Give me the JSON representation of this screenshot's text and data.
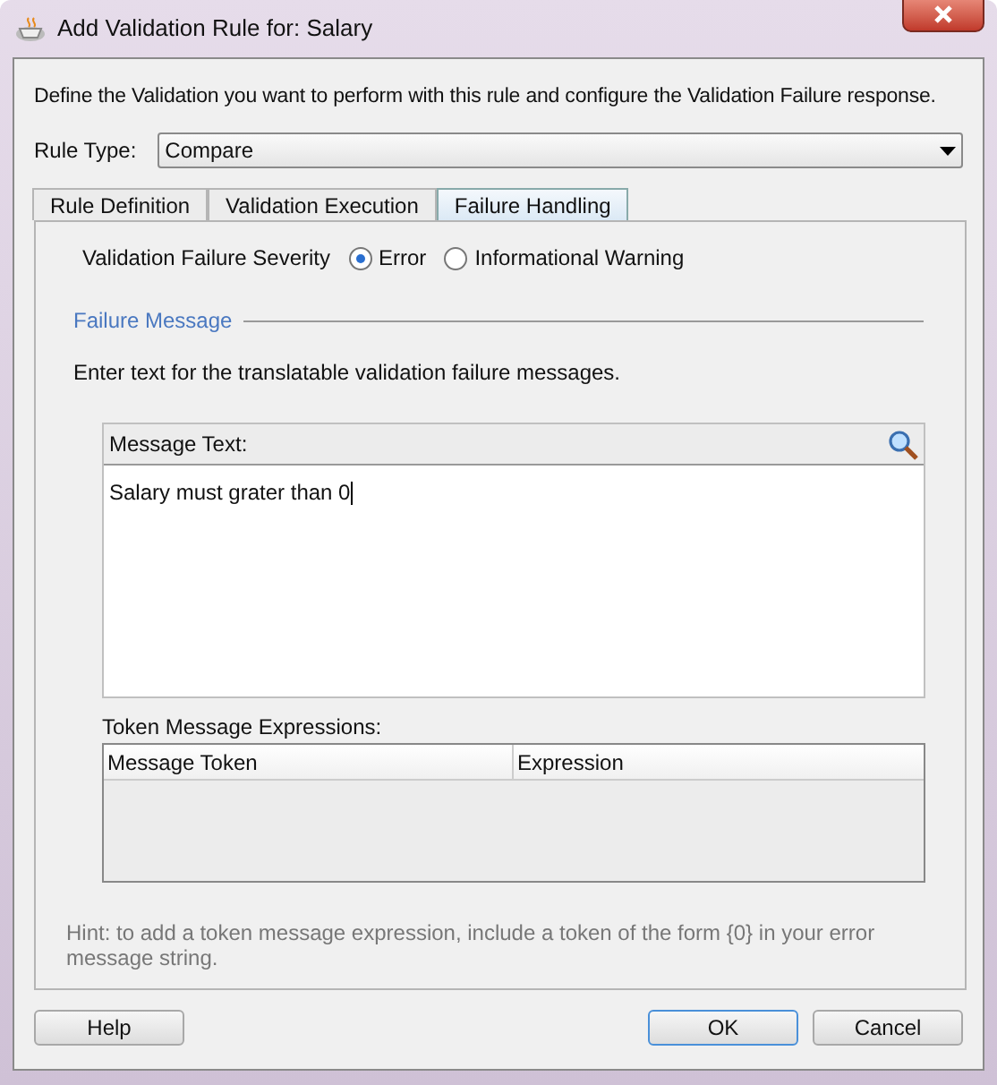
{
  "window": {
    "title": "Add Validation Rule for: Salary"
  },
  "intro": "Define the Validation you want to perform with this rule and configure the Validation Failure response.",
  "rule_type": {
    "label": "Rule Type:",
    "value": "Compare"
  },
  "tabs": [
    {
      "label": "Rule Definition",
      "selected": false
    },
    {
      "label": "Validation Execution",
      "selected": false
    },
    {
      "label": "Failure Handling",
      "selected": true
    }
  ],
  "severity": {
    "label": "Validation Failure Severity",
    "options": [
      {
        "label": "Error",
        "selected": true
      },
      {
        "label": "Informational Warning",
        "selected": false
      }
    ]
  },
  "failure_message": {
    "heading": "Failure Message",
    "instructions": "Enter text for the translatable validation failure messages.",
    "message_label": "Message Text:",
    "message_value": "Salary must grater than 0"
  },
  "token_table": {
    "label": "Token Message Expressions:",
    "columns": [
      "Message Token",
      "Expression"
    ]
  },
  "hint": "Hint: to add a token message expression, include a token of the form {0} in your error message string.",
  "buttons": {
    "help": "Help",
    "ok": "OK",
    "cancel": "Cancel"
  }
}
